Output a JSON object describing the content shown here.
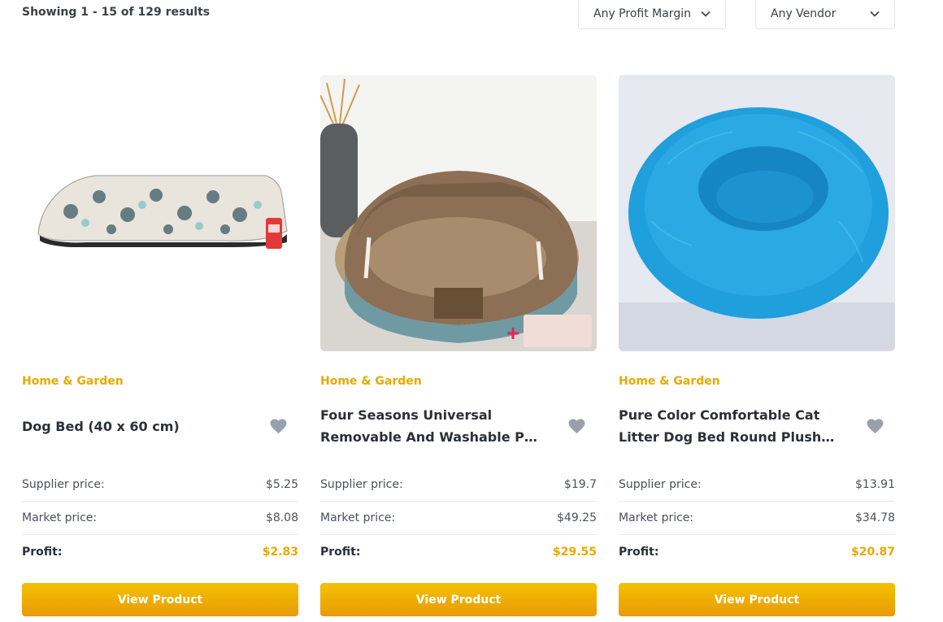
{
  "header": {
    "results_text": "Showing 1 - 15 of 129 results",
    "profit_filter": "Any Profit Margin",
    "vendor_filter": "Any Vendor"
  },
  "labels": {
    "supplier": "Supplier price:",
    "market": "Market price:",
    "profit": "Profit:",
    "view": "View Product"
  },
  "products": [
    {
      "category": "Home & Garden",
      "title": "Dog Bed (40 x 60 cm)",
      "supplier_price": "$5.25",
      "market_price": "$8.08",
      "profit": "$2.83"
    },
    {
      "category": "Home & Garden",
      "title": "Four Seasons Universal Removable And Washable Pet Bed",
      "supplier_price": "$19.7",
      "market_price": "$49.25",
      "profit": "$29.55"
    },
    {
      "category": "Home & Garden",
      "title": "Pure Color Comfortable Cat Litter Dog Bed Round Plush Bed",
      "supplier_price": "$13.91",
      "market_price": "$34.78",
      "profit": "$20.87"
    }
  ],
  "colors": {
    "accent": "#e8a900",
    "button_top": "#f5c100",
    "button_bottom": "#e89a06",
    "heart": "#9aa0ab"
  }
}
